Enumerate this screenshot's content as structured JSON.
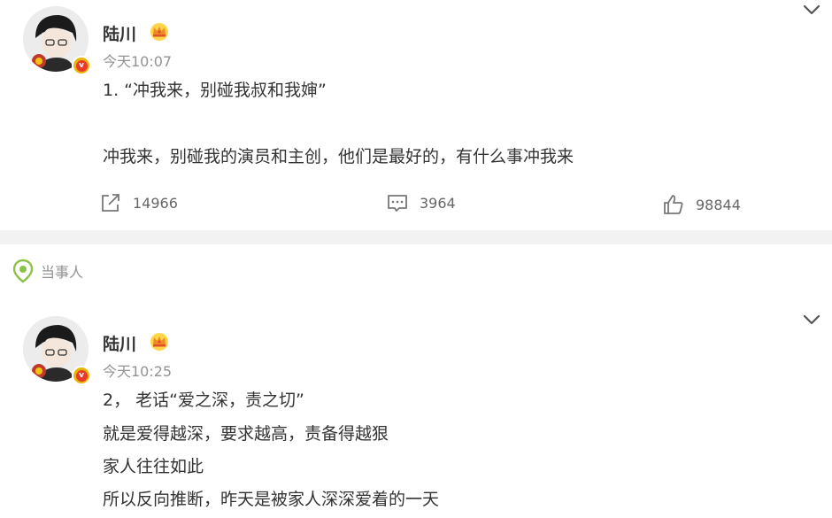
{
  "post1": {
    "author": "陆川",
    "time": "今天10:07",
    "verified_mark": "v",
    "lines": [
      "1. “冲我来，别碰我叔和我婶”",
      "冲我来，别碰我的演员和主创，他们是最好的，有什么事冲我来"
    ],
    "actions": {
      "repost_count": "14966",
      "comment_count": "3964",
      "like_count": "98844"
    }
  },
  "section_tag": {
    "label": "当事人",
    "icon": "location-pin-icon"
  },
  "post2": {
    "author": "陆川",
    "time": "今天10:25",
    "verified_mark": "v",
    "lines": [
      "2， 老话“爱之深，责之切”",
      "就是爱得越深，要求越高，责备得越狠",
      "家人往往如此",
      "所以反向推断，昨天是被家人深深爱着的一天"
    ]
  },
  "colors": {
    "text": "#333333",
    "muted": "#939393",
    "divider": "#f2f2f2",
    "verified_badge": "#e8b600",
    "tag_green": "#8bc34a"
  }
}
